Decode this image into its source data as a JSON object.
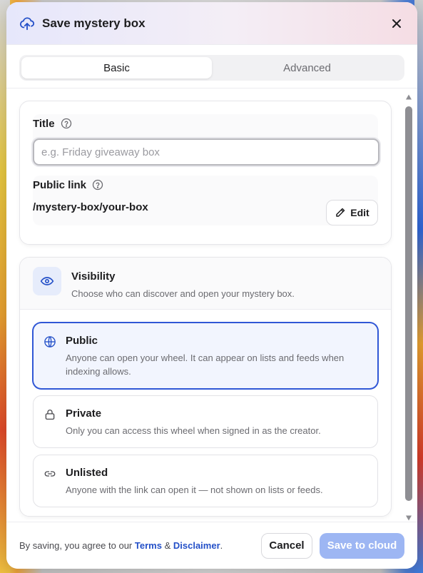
{
  "header": {
    "title": "Save mystery box",
    "icon": "cloud-upload-icon",
    "close_icon": "close-icon"
  },
  "tabs": [
    {
      "label": "Basic",
      "active": true
    },
    {
      "label": "Advanced",
      "active": false
    }
  ],
  "details": {
    "title_label": "Title",
    "title_placeholder": "e.g. Friday giveaway box",
    "title_value": "",
    "link_label": "Public link",
    "link_value": "/mystery-box/your-box",
    "edit_label": "Edit"
  },
  "visibility": {
    "title": "Visibility",
    "subtitle": "Choose who can discover and open your mystery box.",
    "options": [
      {
        "title": "Public",
        "desc": "Anyone can open your wheel. It can appear on lists and feeds when indexing allows.",
        "icon": "globe-icon",
        "selected": true
      },
      {
        "title": "Private",
        "desc": "Only you can access this wheel when signed in as the creator.",
        "icon": "lock-icon",
        "selected": false
      },
      {
        "title": "Unlisted",
        "desc": "Anyone with the link can open it — not shown on lists or feeds.",
        "icon": "link-icon",
        "selected": false
      }
    ]
  },
  "footer": {
    "agree_prefix": "By saving, you agree to our",
    "terms": "Terms",
    "amp": "&",
    "disclaimer": "Disclaimer",
    "period": ".",
    "cancel_label": "Cancel",
    "save_label": "Save to cloud"
  },
  "colors": {
    "accent": "#3057d6",
    "save_disabled": "#9db6f3",
    "link": "#2450c8"
  }
}
